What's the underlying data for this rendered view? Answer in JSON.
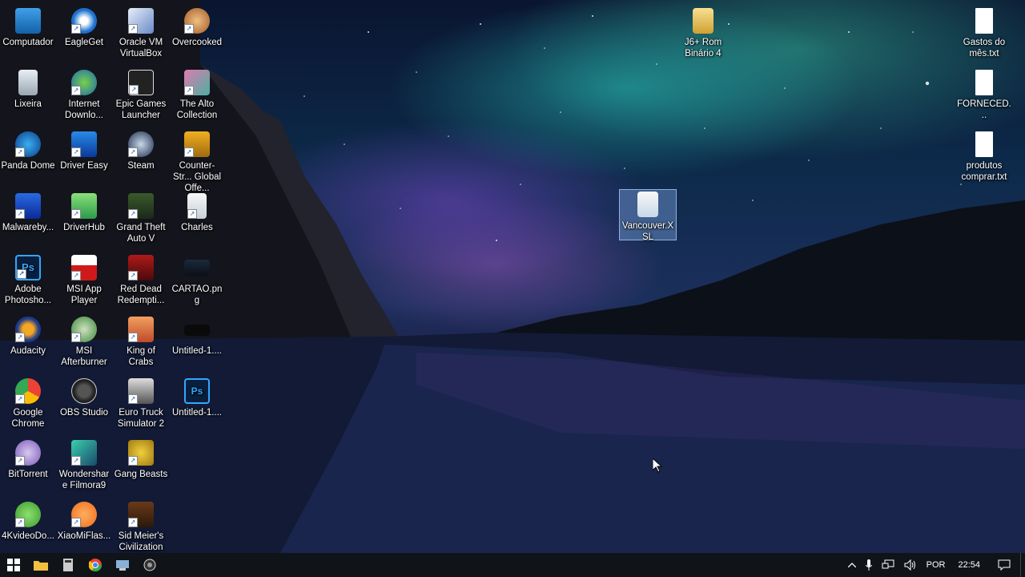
{
  "desktop_icons": {
    "col1": [
      {
        "label": "Computador"
      },
      {
        "label": "Lixeira"
      },
      {
        "label": "Panda Dome"
      },
      {
        "label": "Malwareby..."
      },
      {
        "label": "Adobe Photosho..."
      },
      {
        "label": "Audacity"
      },
      {
        "label": "Google Chrome"
      },
      {
        "label": "BitTorrent"
      },
      {
        "label": "4KvideoDo..."
      }
    ],
    "col2": [
      {
        "label": "EagleGet"
      },
      {
        "label": "Internet Downlo..."
      },
      {
        "label": "Driver Easy"
      },
      {
        "label": "DriverHub"
      },
      {
        "label": "MSI App Player"
      },
      {
        "label": "MSI Afterburner"
      },
      {
        "label": "OBS Studio"
      },
      {
        "label": "Wondershare Filmora9"
      },
      {
        "label": "XiaoMiFlas..."
      }
    ],
    "col3": [
      {
        "label": "Oracle VM VirtualBox"
      },
      {
        "label": "Epic Games Launcher"
      },
      {
        "label": "Steam"
      },
      {
        "label": "Grand Theft Auto V"
      },
      {
        "label": "Red Dead Redempti..."
      },
      {
        "label": "King of Crabs"
      },
      {
        "label": "Euro Truck Simulator 2"
      },
      {
        "label": "Gang Beasts"
      },
      {
        "label": "Sid Meier's Civilization VI"
      }
    ],
    "col4": [
      {
        "label": "Overcooked"
      },
      {
        "label": "The Alto Collection"
      },
      {
        "label": "Counter-Str... Global Offe..."
      },
      {
        "label": "Charles"
      },
      {
        "label": "CARTAO.png"
      },
      {
        "label": "Untitled-1...."
      },
      {
        "label": "Untitled-1...."
      }
    ],
    "middle": [
      {
        "label": "J6+ Rom Binário 4"
      },
      {
        "label": "Vancouver.XSL"
      }
    ],
    "right": [
      {
        "label": "Gastos do mês.txt"
      },
      {
        "label": "FORNECED..."
      },
      {
        "label": "produtos comprar.txt"
      }
    ]
  },
  "taskbar": {
    "language": "POR",
    "time": "22:54"
  },
  "icon_names": {
    "start": "windows-start-icon",
    "explorer": "file-explorer-icon",
    "calculator": "calculator-icon",
    "chrome": "chrome-icon",
    "network": "network-icon",
    "obs": "obs-icon"
  }
}
